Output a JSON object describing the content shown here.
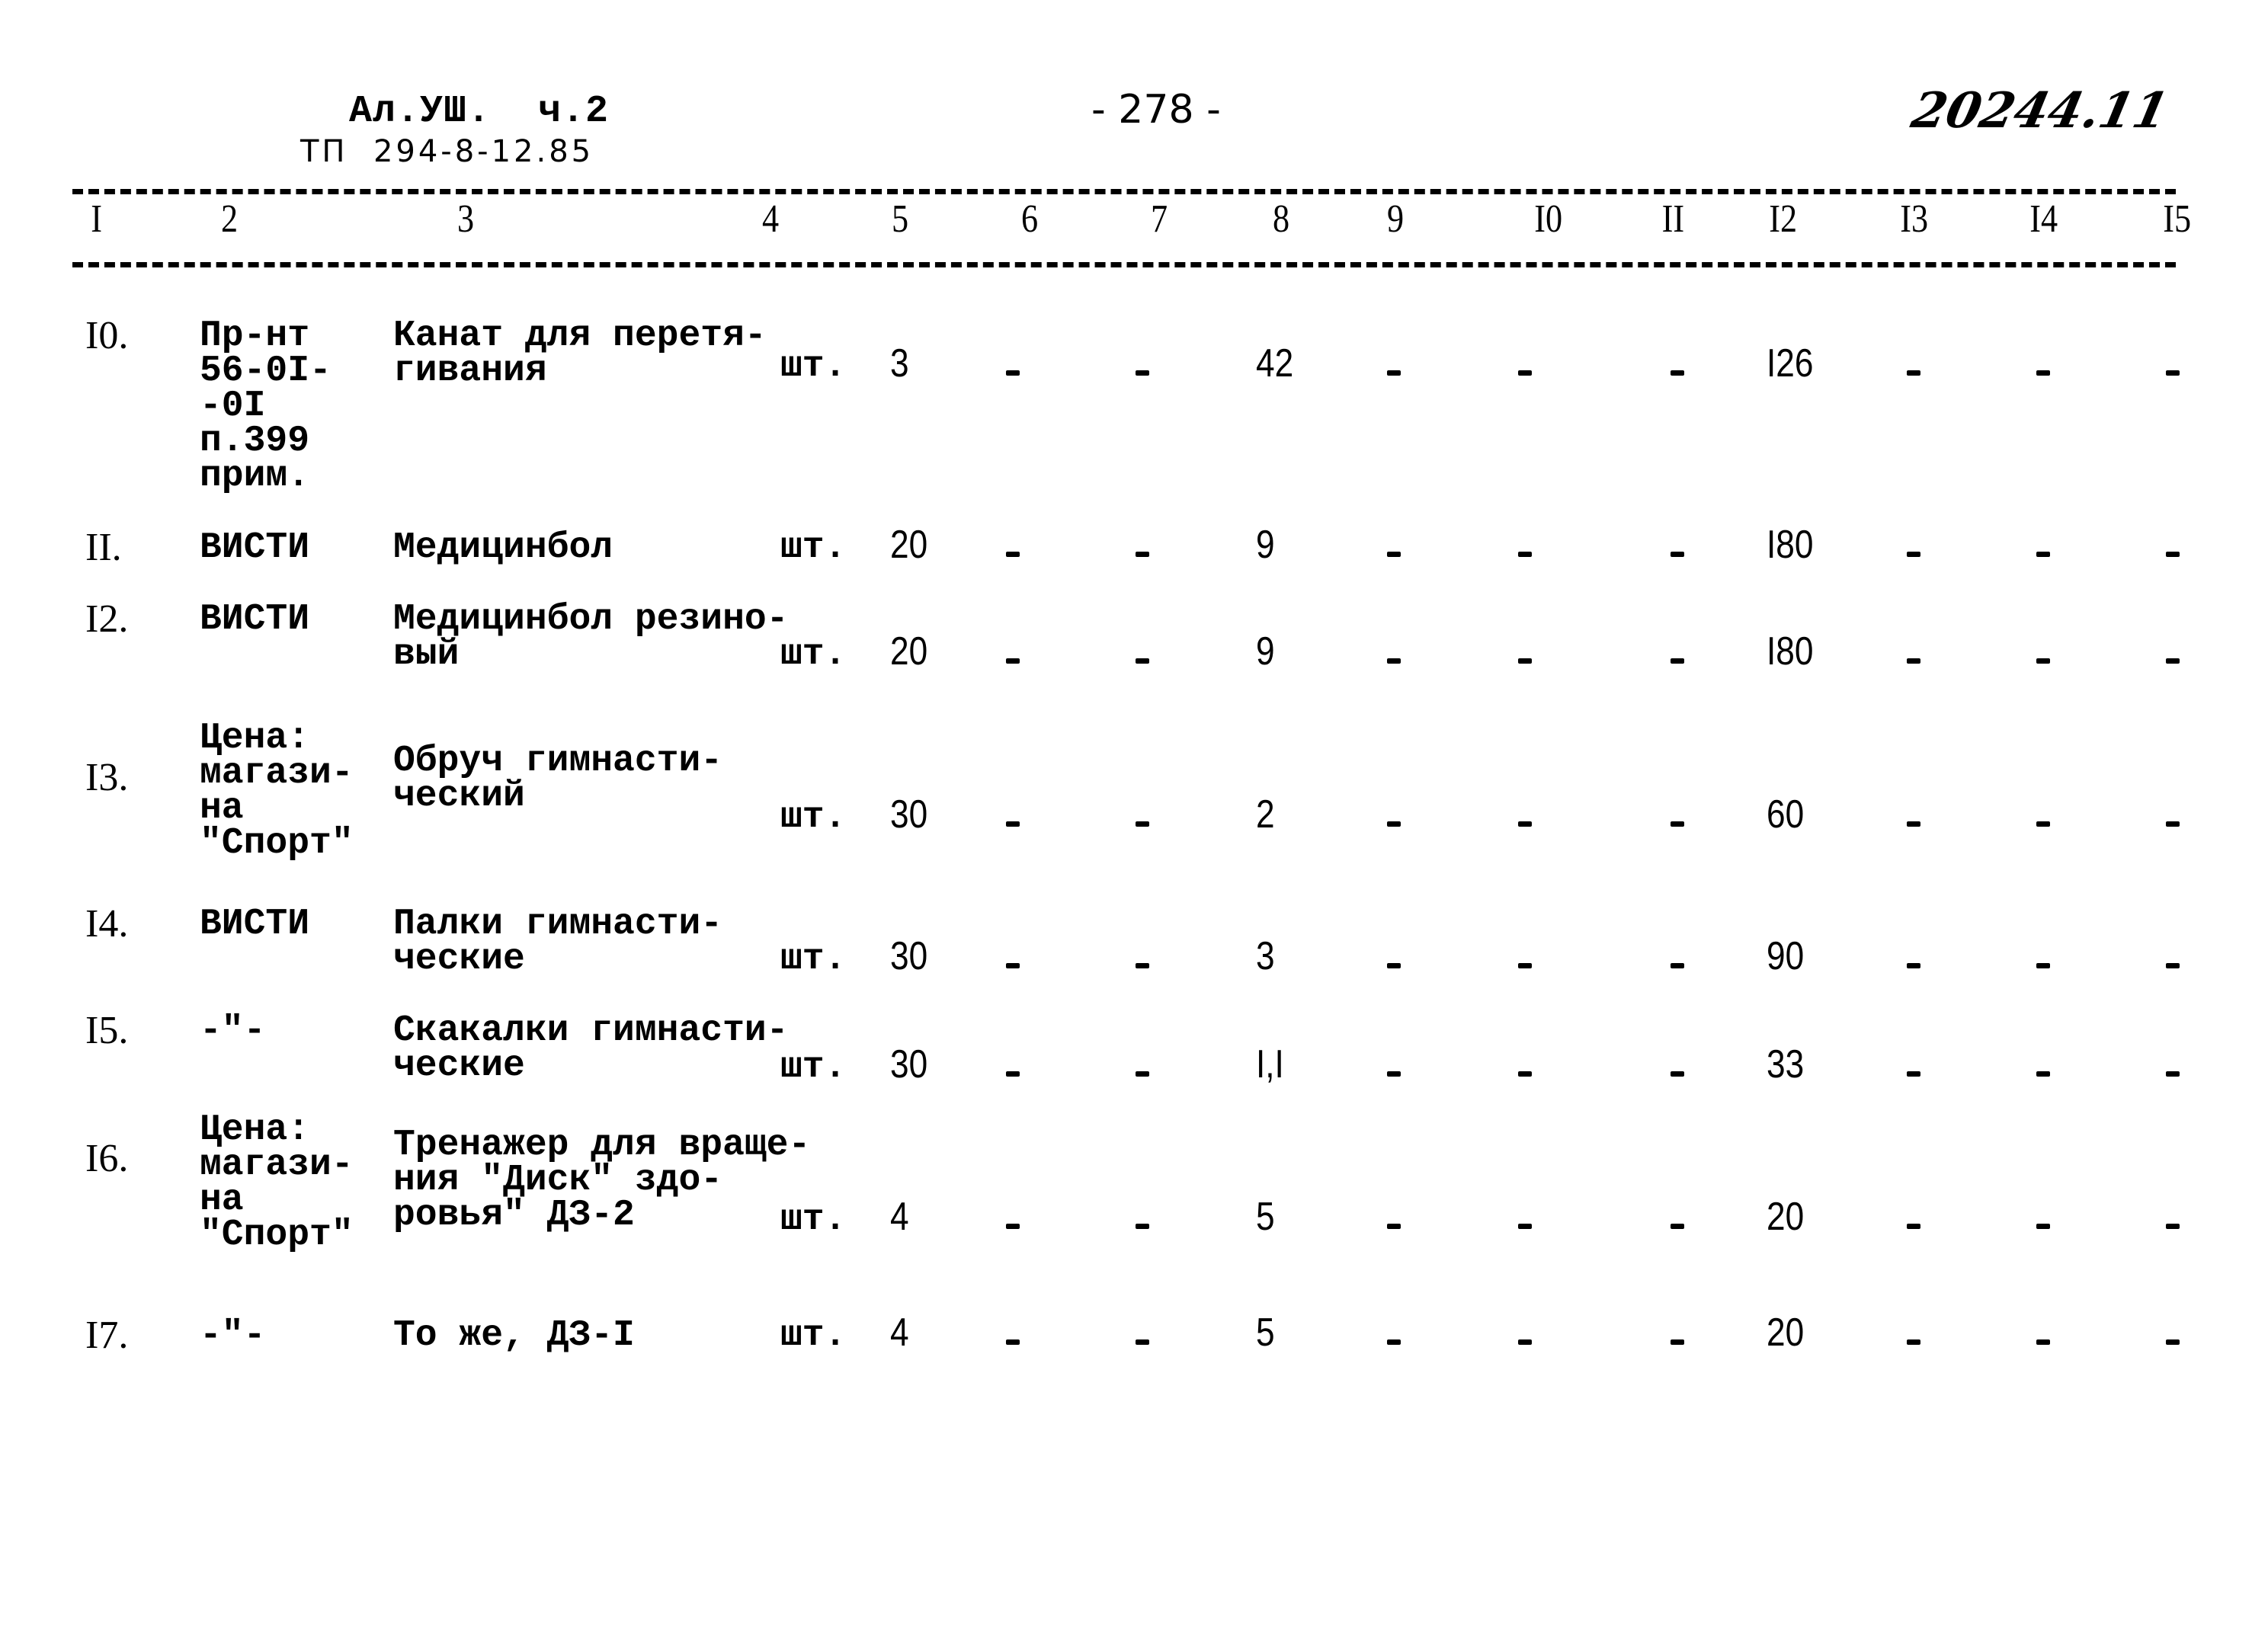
{
  "header": {
    "title": "Ал.УШ.  ч.2",
    "subtitle": "ТП  294-8-12.85",
    "page_number": "- 278 -",
    "handwritten_number": "20244.11"
  },
  "table": {
    "column_numbers": [
      "I",
      "2",
      "3",
      "4",
      "5",
      "6",
      "7",
      "8",
      "9",
      "I0",
      "II",
      "I2",
      "I3",
      "I4",
      "I5"
    ],
    "rows": [
      {
        "num": "I0.",
        "source": "Пр-нт\n56-0I-\n-0I\nп.399\nприм.",
        "name": "Канат для перетя-\nгивания",
        "unit": "шт.",
        "c5": "3",
        "c6": "-",
        "c7": "-",
        "c8": "42",
        "c9": "-",
        "c10": "-",
        "c11": "-",
        "c12": "I26",
        "c13": "-",
        "c14": "-",
        "c15": "-"
      },
      {
        "num": "II.",
        "source": "ВИСТИ",
        "name": "Медицинбол",
        "unit": "шт.",
        "c5": "20",
        "c6": "-",
        "c7": "-",
        "c8": "9",
        "c9": "-",
        "c10": "-",
        "c11": "-",
        "c12": "I80",
        "c13": "-",
        "c14": "-",
        "c15": "-"
      },
      {
        "num": "I2.",
        "source": "ВИСТИ",
        "name": "Медицинбол резино-\nвый",
        "unit": "шт.",
        "c5": "20",
        "c6": "-",
        "c7": "-",
        "c8": "9",
        "c9": "-",
        "c10": "-",
        "c11": "-",
        "c12": "I80",
        "c13": "-",
        "c14": "-",
        "c15": "-"
      },
      {
        "num": "I3.",
        "source": "Цена:\nмагази-\nна\n\"Спорт\"",
        "name": "Обруч гимнасти-\nческий",
        "unit": "шт.",
        "c5": "30",
        "c6": "-",
        "c7": "-",
        "c8": "2",
        "c9": "-",
        "c10": "-",
        "c11": "-",
        "c12": "60",
        "c13": "-",
        "c14": "-",
        "c15": "-"
      },
      {
        "num": "I4.",
        "source": "ВИСТИ",
        "name": "Палки гимнасти-\nческие",
        "unit": "шт.",
        "c5": "30",
        "c6": "-",
        "c7": "-",
        "c8": "3",
        "c9": "-",
        "c10": "-",
        "c11": "-",
        "c12": "90",
        "c13": "-",
        "c14": "-",
        "c15": "-"
      },
      {
        "num": "I5.",
        "source": "-\"-",
        "name": "Скакалки гимнасти-\nческие",
        "unit": "шт.",
        "c5": "30",
        "c6": "-",
        "c7": "-",
        "c8": "I,I",
        "c9": "-",
        "c10": "-",
        "c11": "-",
        "c12": "33",
        "c13": "-",
        "c14": "-",
        "c15": "-"
      },
      {
        "num": "I6.",
        "source": "Цена:\nмагази-\nна\n\"Спорт\"",
        "name": "Тренажер для враще-\nния \"Диск\" здо-\nровья\" ДЗ-2",
        "unit": "шт.",
        "c5": "4",
        "c6": "-",
        "c7": "-",
        "c8": "5",
        "c9": "-",
        "c10": "-",
        "c11": "-",
        "c12": "20",
        "c13": "-",
        "c14": "-",
        "c15": "-"
      },
      {
        "num": "I7.",
        "source": "-\"-",
        "name": "То же, ДЗ-I",
        "unit": "шт.",
        "c5": "4",
        "c6": "-",
        "c7": "-",
        "c8": "5",
        "c9": "-",
        "c10": "-",
        "c11": "-",
        "c12": "20",
        "c13": "-",
        "c14": "-",
        "c15": "-"
      }
    ]
  }
}
